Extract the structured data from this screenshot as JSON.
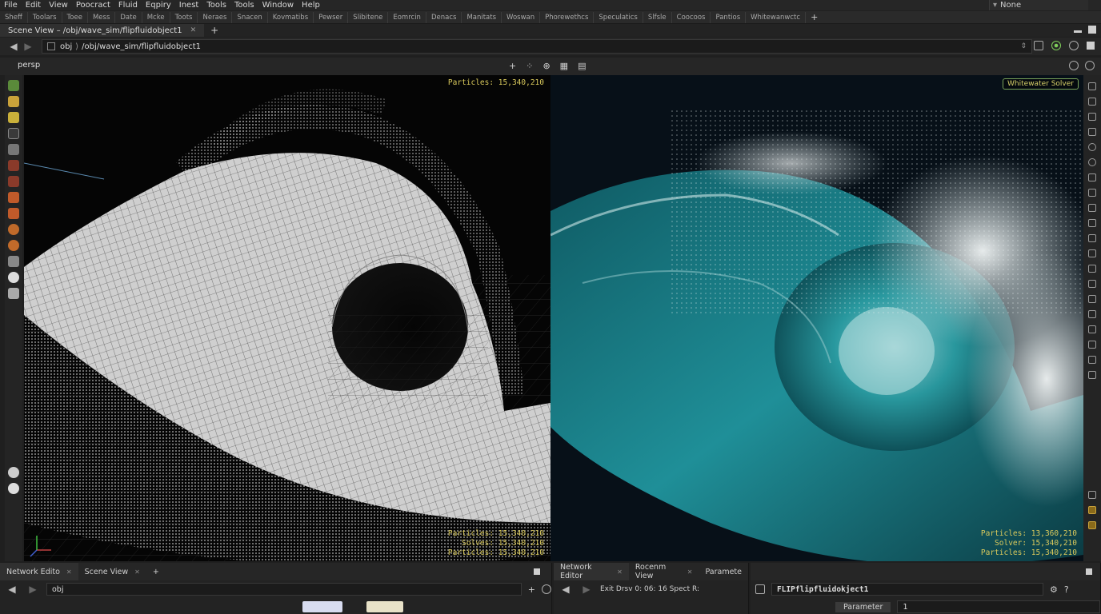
{
  "menu": [
    "File",
    "Edit",
    "View",
    "Poocract",
    "Fluid",
    "Eqpiry",
    "Inest",
    "Tools",
    "Tools",
    "Window",
    "Help"
  ],
  "desktop_selector": "None",
  "shelf_tabs": [
    "Sheff",
    "Toolars",
    "Toee",
    "Mess",
    "Date",
    "Mcke",
    "Toots",
    "Neraes",
    "Snacen",
    "Kovmatibs",
    "Pewser",
    "Slibitene",
    "Eomrcin",
    "Denacs",
    "Manitats",
    "Woswan",
    "Phorewethcs",
    "Speculatics",
    "Slfsle",
    "Coocoos",
    "Pantios",
    "Whitewanwctc"
  ],
  "scene_tab": "Scene View – /obj/wave_sim/flipfluidobject1",
  "path": {
    "root": "obj",
    "separator": "⟩",
    "full": "/obj/wave_sim/flipfluidobject1"
  },
  "viewport": {
    "camera": "persp",
    "left_particles": "Particles: 15,340,210",
    "left_bottom": [
      "Particles: 15,340,210",
      "Solves: 15,340,210",
      "Particles: 15,340,210"
    ],
    "right_badge": "Whitewater Solver",
    "right_bottom": [
      "Particles: 13,360,210",
      "Solver: 15,340,210",
      "Particles: 15,340,210"
    ]
  },
  "bottom_left": {
    "tabs": [
      "Network Edito",
      "Scene View"
    ],
    "path": "obj"
  },
  "bottom_mid": {
    "tabs": [
      "Network Editor",
      "Rocenm View",
      "Paramete"
    ],
    "toolbar": "Exit   Drsv 0:  06:  16 Spect R:"
  },
  "bottom_right": {
    "node_name": "FLIPflipfluidokject1",
    "param_label": "Parameter",
    "param_value": "1"
  },
  "colors": {
    "accent_yellow": "#d9c95c",
    "water_teal": "#1f8f98",
    "green_icon": "#7fd05a"
  }
}
